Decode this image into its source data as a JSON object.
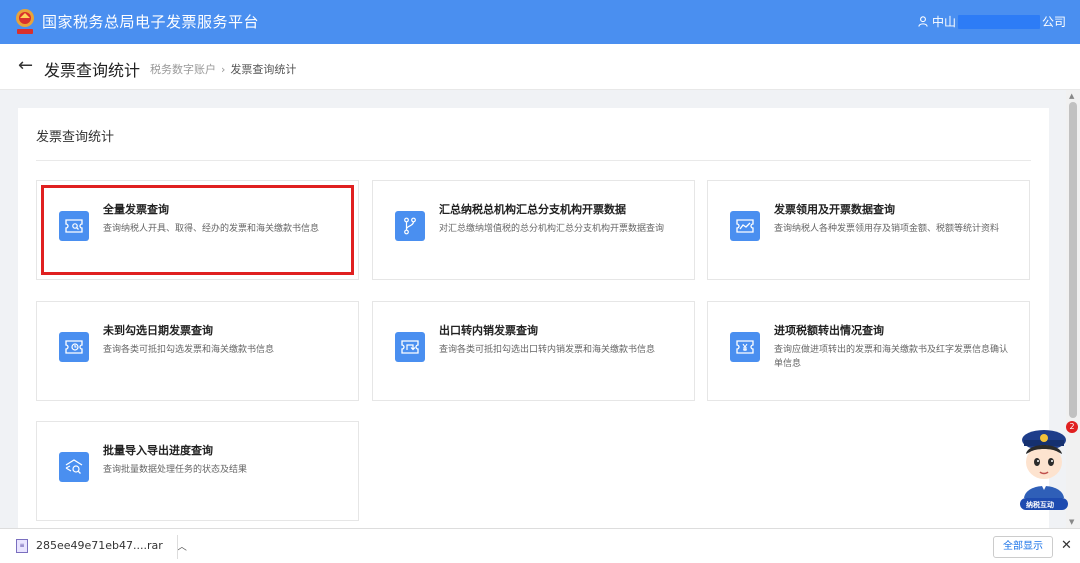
{
  "app": {
    "title": "国家税务总局电子发票服务平台",
    "user_prefix": "中山",
    "user_suffix": "公司"
  },
  "header": {
    "page_title": "发票查询统计",
    "breadcrumb": [
      "税务数字账户",
      "发票查询统计"
    ],
    "breadcrumb_sep": "›"
  },
  "panel": {
    "title": "发票查询统计",
    "cards": [
      {
        "title": "全量发票查询",
        "desc": "查询纳税人开具、取得、经办的发票和海关缴款书信息",
        "icon": "invoice-search-icon",
        "selected": true
      },
      {
        "title": "汇总纳税总机构汇总分支机构开票数据",
        "desc": "对汇总缴纳增值税的总分机构汇总分支机构开票数据查询",
        "icon": "branch-icon",
        "selected": false
      },
      {
        "title": "发票领用及开票数据查询",
        "desc": "查询纳税人各种发票领用存及销项金额、税额等统计资料",
        "icon": "trend-chart-icon",
        "selected": false
      },
      {
        "title": "未到勾选日期发票查询",
        "desc": "查询各类可抵扣勾选发票和海关缴款书信息",
        "icon": "clock-ticket-icon",
        "selected": false
      },
      {
        "title": "出口转内销发票查询",
        "desc": "查询各类可抵扣勾选出口转内销发票和海关缴款书信息",
        "icon": "export-return-icon",
        "selected": false
      },
      {
        "title": "进项税额转出情况查询",
        "desc": "查询应做进项转出的发票和海关缴款书及红字发票信息确认单信息",
        "icon": "yen-ticket-icon",
        "selected": false
      },
      {
        "title": "批量导入导出进度查询",
        "desc": "查询批量数据处理任务的状态及结果",
        "icon": "batch-search-icon",
        "selected": false
      }
    ]
  },
  "assistant": {
    "badge": "2",
    "label": "纳税互动"
  },
  "download": {
    "file_name": "285ee49e71eb47....rar",
    "show_all": "全部显示"
  },
  "colors": {
    "accent": "#4a8ff0",
    "selected_outline": "#e02020"
  }
}
